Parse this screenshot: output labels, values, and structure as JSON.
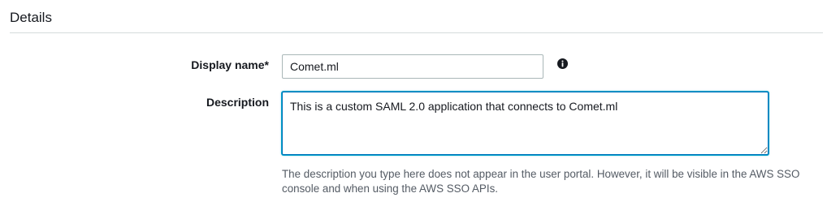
{
  "section": {
    "title": "Details"
  },
  "form": {
    "display_name": {
      "label": "Display name*",
      "value": "Comet.ml"
    },
    "description": {
      "label": "Description",
      "value": "This is a custom SAML 2.0 application that connects to Comet.ml",
      "help": "The description you type here does not appear in the user portal. However, it will be visible in the AWS SSO console and when using the AWS SSO APIs."
    },
    "info_icon": "info-circle-icon"
  },
  "colors": {
    "text": "#16191f",
    "help_text": "#545b64",
    "focus_border": "#0073bb",
    "input_border": "#aab7b8",
    "divider": "#d5dbdb"
  }
}
